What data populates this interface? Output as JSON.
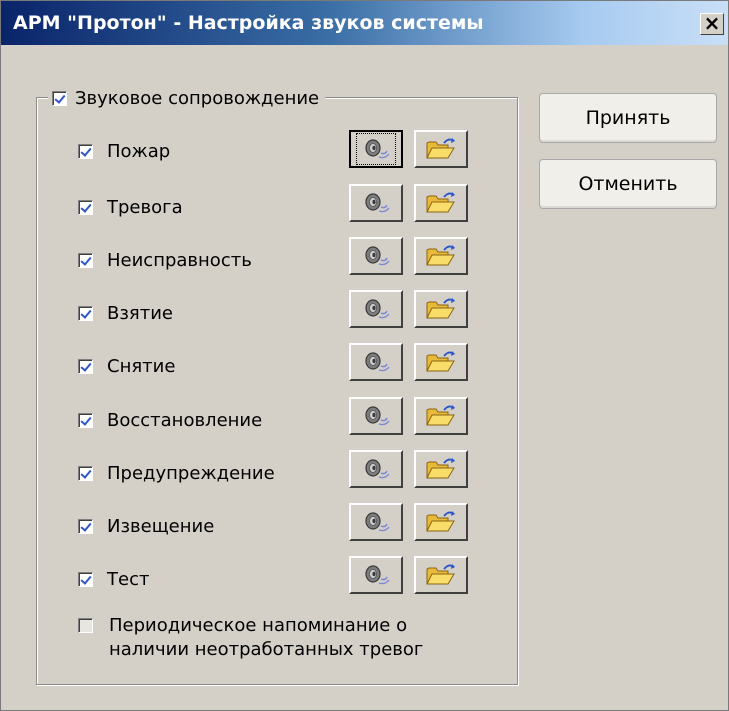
{
  "window": {
    "title": "АРМ \"Протон\" - Настройка звуков системы",
    "close_glyph": "×"
  },
  "group": {
    "label": "Звуковое сопровождение",
    "checked": true
  },
  "events": [
    {
      "label": "Пожар",
      "checked": true
    },
    {
      "label": "Тревога",
      "checked": true
    },
    {
      "label": "Неисправность",
      "checked": true
    },
    {
      "label": "Взятие",
      "checked": true
    },
    {
      "label": "Снятие",
      "checked": true
    },
    {
      "label": "Восстановление",
      "checked": true
    },
    {
      "label": "Предупреждение",
      "checked": true
    },
    {
      "label": "Извещение",
      "checked": true
    },
    {
      "label": "Тест",
      "checked": true
    }
  ],
  "icons": {
    "play": "speaker-icon",
    "open": "folder-open-icon"
  },
  "periodic": {
    "line1": "Периодическое напоминание о",
    "line2": "наличии неотработанных тревог",
    "checked": false
  },
  "buttons": {
    "accept": "Принять",
    "cancel": "Отменить"
  }
}
